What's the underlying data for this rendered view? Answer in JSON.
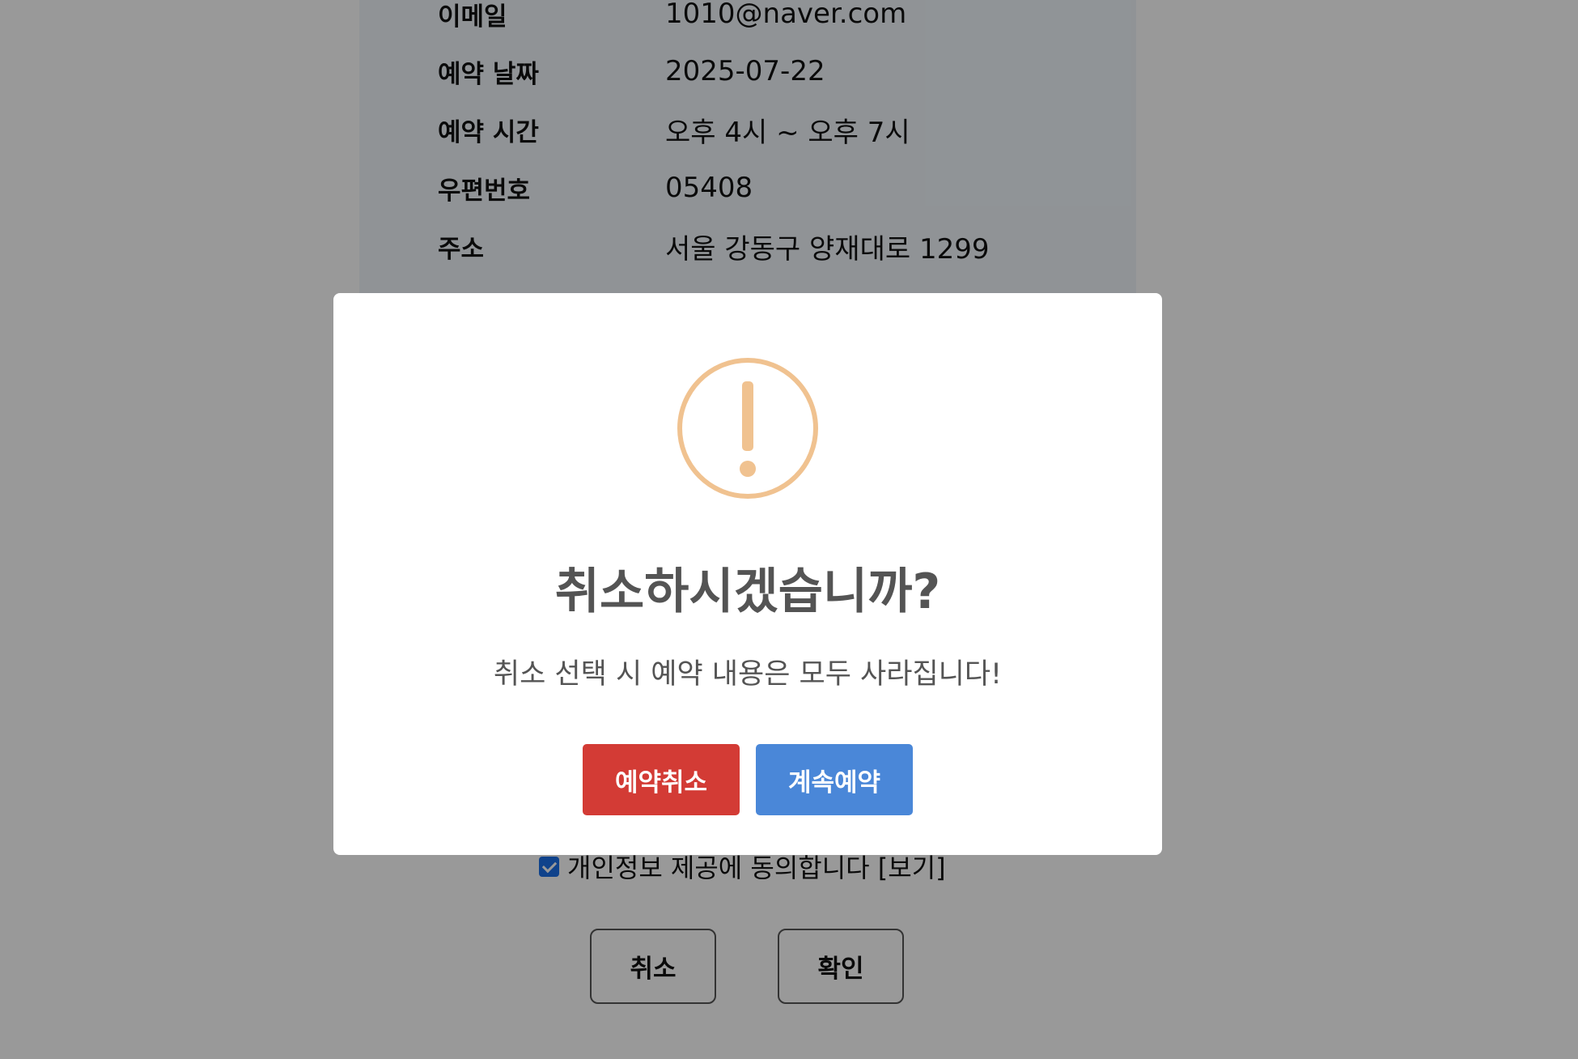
{
  "reservation": {
    "rows": [
      {
        "label": "이메일",
        "value": "1010@naver.com"
      },
      {
        "label": "예약 날짜",
        "value": "2025-07-22"
      },
      {
        "label": "예약 시간",
        "value": "오후 4시 ~ 오후 7시"
      },
      {
        "label": "우편번호",
        "value": "05408"
      },
      {
        "label": "주소",
        "value": "서울 강동구 양재대로 1299"
      }
    ]
  },
  "consent": {
    "checked": true,
    "label": "개인정보 제공에 동의합니다 [보기]"
  },
  "page_buttons": {
    "cancel": "취소",
    "confirm": "확인"
  },
  "modal": {
    "icon": "exclamation-icon",
    "icon_color": "#f0c290",
    "title": "취소하시겠습니까?",
    "text": "취소 선택 시 예약 내용은 모두 사라집니다!",
    "confirm_button": "예약취소",
    "confirm_color": "#d33b35",
    "continue_button": "계속예약",
    "continue_color": "#4a87d8"
  }
}
